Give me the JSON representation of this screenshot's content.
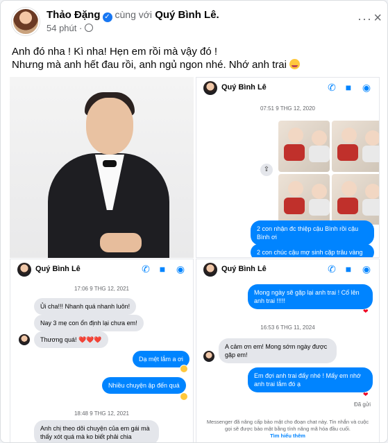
{
  "post": {
    "author": "Thảo Đặng",
    "with_text": "cùng với",
    "tagged": "Quý Bình Lê.",
    "time": "54 phút ·",
    "line1": "Anh đó nha ! Kì nha! Hẹn em rồi mà vậy đó !",
    "line2": "Nhưng mà anh hết đau rồi, anh ngủ ngon nhé. Nhớ anh trai"
  },
  "shot1": {
    "contact": "Quý Bình Lê",
    "stamp": "07:51 9 THG 12, 2020",
    "msg_out_1": "2 con nhận đc thiệp cậu Bình rồi cậu Bình ơi",
    "msg_out_2": "2 con chúc cậu mợ sinh cặp trâu vàng"
  },
  "shot2": {
    "contact": "Quý Bình Lê",
    "stamp1": "17:06 9 THG 12, 2021",
    "msg_in_1": "Ủi cha!!! Nhanh quá nhanh luôn!",
    "msg_in_2": "Nay 3 mẹ con ổn định lại chưa em!",
    "msg_in_3": "Thương quá! ❤️❤️❤️",
    "msg_out_1": "Dạ mệt lắm a ơi",
    "msg_out_2": "Nhiều chuyện ập đến quá",
    "stamp2": "18:48 9 THG 12, 2021",
    "msg_in_4": "Anh chị theo dõi chuyện của em gái mà thấy xót quá mà ko biết phải chia"
  },
  "shot3": {
    "contact": "Quý Bình Lê",
    "msg_out_1": "Mong ngày sẽ gặp lại anh trai ! Cố lên anh trai !!!!!",
    "stamp1": "16:53 6 THG 11, 2024",
    "msg_in_1": "A cảm ơn em! Mong sớm ngày được gặp em!",
    "msg_out_2": "Em đợi anh trai đấy nhé ! Mấy em nhớ anh trai lắm đó ạ",
    "seen": "Đã gửi",
    "notice": "Messenger đã nâng cấp bảo mật cho đoạn chat này. Tin nhắn và cuộc gọi sẽ được bảo mật bằng tính năng mã hóa đầu cuối.",
    "learn_more": "Tìm hiểu thêm"
  }
}
